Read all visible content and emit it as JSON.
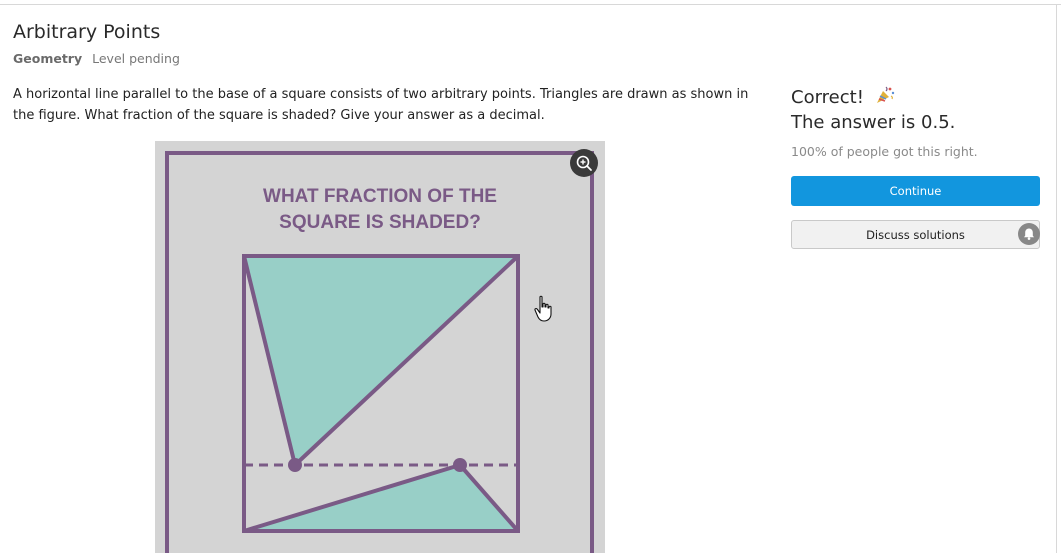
{
  "problem": {
    "title": "Arbitrary Points",
    "topic": "Geometry",
    "level": "Level pending",
    "text": "A horizontal line parallel to the base of a square consists of two arbitrary points. Triangles are drawn as shown in the figure. What fraction of the square is shaded? Give your answer as a decimal."
  },
  "figure": {
    "heading_line1": "WHAT FRACTION OF THE",
    "heading_line2": "SQUARE IS SHADED?",
    "colors": {
      "background": "#d4d4d4",
      "frame": "#7a5a86",
      "shade": "#98cfc7",
      "heading": "#7a5a86"
    }
  },
  "result": {
    "correct_label": "Correct!",
    "celebration_icon": "party-popper-icon",
    "answer_text": "The answer is 0.5.",
    "stats_text": "100% of people got this right."
  },
  "actions": {
    "continue_label": "Continue",
    "discuss_label": "Discuss solutions",
    "continue_color": "#1296de"
  },
  "icons": {
    "zoom": "zoom-in-icon",
    "bell": "bell-icon",
    "cursor": "hand-pointer-icon"
  }
}
